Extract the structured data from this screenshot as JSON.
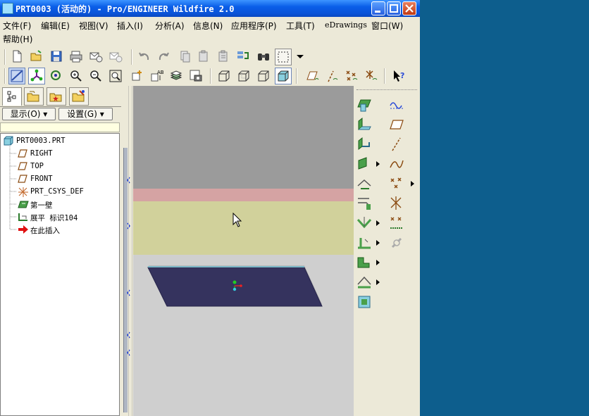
{
  "window": {
    "title": "PRT0003 (活动的) - Pro/ENGINEER Wildfire 2.0"
  },
  "menubar": {
    "items": [
      {
        "label": "文件(F)"
      },
      {
        "label": "编辑(E)"
      },
      {
        "label": "视图(V)"
      },
      {
        "label": "插入(I)"
      },
      {
        "label": "分析(A)"
      },
      {
        "label": "信息(N)"
      },
      {
        "label": "应用程序(P)"
      },
      {
        "label": "工具(T)"
      },
      {
        "label": "eDrawings"
      },
      {
        "label": "窗口(W)"
      },
      {
        "label": "帮助(H)"
      }
    ]
  },
  "navigator": {
    "show_button": "显示(O) ▾",
    "settings_button": "设置(G) ▾",
    "tree": [
      {
        "label": "PRT0003.PRT",
        "icon": "part-icon"
      },
      {
        "label": "RIGHT",
        "icon": "datum-plane-icon"
      },
      {
        "label": "TOP",
        "icon": "datum-plane-icon"
      },
      {
        "label": "FRONT",
        "icon": "datum-plane-icon"
      },
      {
        "label": "PRT_CSYS_DEF",
        "icon": "csys-icon"
      },
      {
        "label": "第一壁",
        "icon": "sheetmetal-wall-icon"
      },
      {
        "label": "展平 标识104",
        "icon": "unbend-icon"
      },
      {
        "label": "在此插入",
        "icon": "insert-here-arrow-icon"
      }
    ]
  },
  "colors": {
    "titlebar": "#0a5ee8",
    "viewport_top": "#9b9b9b",
    "viewport_band_pink": "#d5a3a3",
    "viewport_band_khaki": "#d1d19b",
    "viewport_bottom": "#cfcfcf",
    "part_face": "#35335e",
    "desktop": "#0d5e8d"
  }
}
